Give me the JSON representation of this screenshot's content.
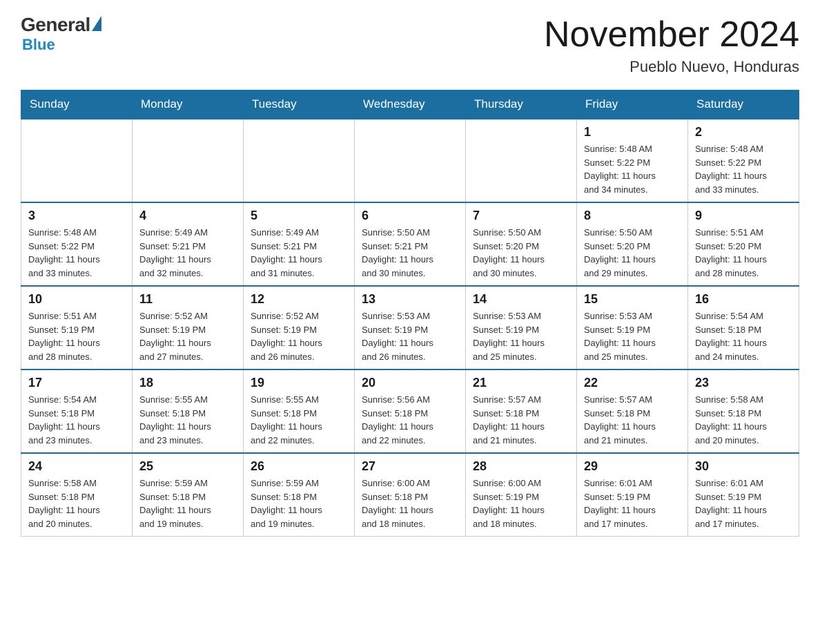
{
  "header": {
    "logo": {
      "general": "General",
      "blue": "Blue"
    },
    "title": "November 2024",
    "location": "Pueblo Nuevo, Honduras"
  },
  "days_of_week": [
    "Sunday",
    "Monday",
    "Tuesday",
    "Wednesday",
    "Thursday",
    "Friday",
    "Saturday"
  ],
  "weeks": [
    {
      "days": [
        {
          "number": "",
          "info": ""
        },
        {
          "number": "",
          "info": ""
        },
        {
          "number": "",
          "info": ""
        },
        {
          "number": "",
          "info": ""
        },
        {
          "number": "",
          "info": ""
        },
        {
          "number": "1",
          "info": "Sunrise: 5:48 AM\nSunset: 5:22 PM\nDaylight: 11 hours\nand 34 minutes."
        },
        {
          "number": "2",
          "info": "Sunrise: 5:48 AM\nSunset: 5:22 PM\nDaylight: 11 hours\nand 33 minutes."
        }
      ]
    },
    {
      "days": [
        {
          "number": "3",
          "info": "Sunrise: 5:48 AM\nSunset: 5:22 PM\nDaylight: 11 hours\nand 33 minutes."
        },
        {
          "number": "4",
          "info": "Sunrise: 5:49 AM\nSunset: 5:21 PM\nDaylight: 11 hours\nand 32 minutes."
        },
        {
          "number": "5",
          "info": "Sunrise: 5:49 AM\nSunset: 5:21 PM\nDaylight: 11 hours\nand 31 minutes."
        },
        {
          "number": "6",
          "info": "Sunrise: 5:50 AM\nSunset: 5:21 PM\nDaylight: 11 hours\nand 30 minutes."
        },
        {
          "number": "7",
          "info": "Sunrise: 5:50 AM\nSunset: 5:20 PM\nDaylight: 11 hours\nand 30 minutes."
        },
        {
          "number": "8",
          "info": "Sunrise: 5:50 AM\nSunset: 5:20 PM\nDaylight: 11 hours\nand 29 minutes."
        },
        {
          "number": "9",
          "info": "Sunrise: 5:51 AM\nSunset: 5:20 PM\nDaylight: 11 hours\nand 28 minutes."
        }
      ]
    },
    {
      "days": [
        {
          "number": "10",
          "info": "Sunrise: 5:51 AM\nSunset: 5:19 PM\nDaylight: 11 hours\nand 28 minutes."
        },
        {
          "number": "11",
          "info": "Sunrise: 5:52 AM\nSunset: 5:19 PM\nDaylight: 11 hours\nand 27 minutes."
        },
        {
          "number": "12",
          "info": "Sunrise: 5:52 AM\nSunset: 5:19 PM\nDaylight: 11 hours\nand 26 minutes."
        },
        {
          "number": "13",
          "info": "Sunrise: 5:53 AM\nSunset: 5:19 PM\nDaylight: 11 hours\nand 26 minutes."
        },
        {
          "number": "14",
          "info": "Sunrise: 5:53 AM\nSunset: 5:19 PM\nDaylight: 11 hours\nand 25 minutes."
        },
        {
          "number": "15",
          "info": "Sunrise: 5:53 AM\nSunset: 5:19 PM\nDaylight: 11 hours\nand 25 minutes."
        },
        {
          "number": "16",
          "info": "Sunrise: 5:54 AM\nSunset: 5:18 PM\nDaylight: 11 hours\nand 24 minutes."
        }
      ]
    },
    {
      "days": [
        {
          "number": "17",
          "info": "Sunrise: 5:54 AM\nSunset: 5:18 PM\nDaylight: 11 hours\nand 23 minutes."
        },
        {
          "number": "18",
          "info": "Sunrise: 5:55 AM\nSunset: 5:18 PM\nDaylight: 11 hours\nand 23 minutes."
        },
        {
          "number": "19",
          "info": "Sunrise: 5:55 AM\nSunset: 5:18 PM\nDaylight: 11 hours\nand 22 minutes."
        },
        {
          "number": "20",
          "info": "Sunrise: 5:56 AM\nSunset: 5:18 PM\nDaylight: 11 hours\nand 22 minutes."
        },
        {
          "number": "21",
          "info": "Sunrise: 5:57 AM\nSunset: 5:18 PM\nDaylight: 11 hours\nand 21 minutes."
        },
        {
          "number": "22",
          "info": "Sunrise: 5:57 AM\nSunset: 5:18 PM\nDaylight: 11 hours\nand 21 minutes."
        },
        {
          "number": "23",
          "info": "Sunrise: 5:58 AM\nSunset: 5:18 PM\nDaylight: 11 hours\nand 20 minutes."
        }
      ]
    },
    {
      "days": [
        {
          "number": "24",
          "info": "Sunrise: 5:58 AM\nSunset: 5:18 PM\nDaylight: 11 hours\nand 20 minutes."
        },
        {
          "number": "25",
          "info": "Sunrise: 5:59 AM\nSunset: 5:18 PM\nDaylight: 11 hours\nand 19 minutes."
        },
        {
          "number": "26",
          "info": "Sunrise: 5:59 AM\nSunset: 5:18 PM\nDaylight: 11 hours\nand 19 minutes."
        },
        {
          "number": "27",
          "info": "Sunrise: 6:00 AM\nSunset: 5:18 PM\nDaylight: 11 hours\nand 18 minutes."
        },
        {
          "number": "28",
          "info": "Sunrise: 6:00 AM\nSunset: 5:19 PM\nDaylight: 11 hours\nand 18 minutes."
        },
        {
          "number": "29",
          "info": "Sunrise: 6:01 AM\nSunset: 5:19 PM\nDaylight: 11 hours\nand 17 minutes."
        },
        {
          "number": "30",
          "info": "Sunrise: 6:01 AM\nSunset: 5:19 PM\nDaylight: 11 hours\nand 17 minutes."
        }
      ]
    }
  ]
}
